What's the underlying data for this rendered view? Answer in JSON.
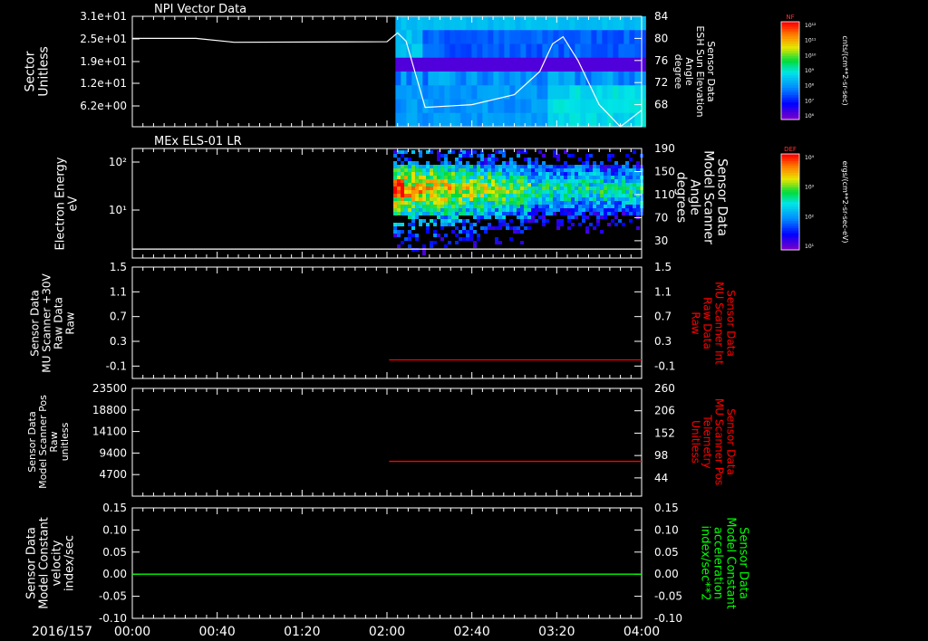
{
  "date_label": "2016/157",
  "time_ticks": [
    "00:00",
    "00:40",
    "01:20",
    "02:00",
    "02:40",
    "03:20",
    "04:00"
  ],
  "colors": {
    "background": "#000000",
    "foreground": "#ffffff",
    "red_trace": "#ff0000",
    "green_trace": "#00ff00"
  },
  "colorbars": [
    {
      "label": "NF",
      "unit": "cnts/(cm**2-sr-sec)",
      "ticks": [
        "10¹²",
        "10¹¹",
        "10¹⁰",
        "10⁹",
        "10⁸",
        "10⁷",
        "10⁶"
      ]
    },
    {
      "label": "DEF",
      "unit": "ergs/(cm**2-sr-sec-eV)",
      "ticks": [
        "10⁴",
        "10³",
        "10²",
        "10¹"
      ]
    }
  ],
  "chart_data": [
    {
      "type": "heatmap",
      "title": "NPI Vector Data",
      "ylabel": [
        "Sector",
        "Unitless"
      ],
      "left_ticks": [
        "3.1e+01",
        "2.5e+01",
        "1.9e+01",
        "1.2e+01",
        "6.2e+00"
      ],
      "right_ylabel": [
        "Sensor Data",
        "ESH Sun Elevation",
        "Angle",
        "degree"
      ],
      "right_ticks": [
        "84",
        "80",
        "76",
        "72",
        "68"
      ],
      "right_ylim": [
        64,
        84
      ],
      "data_start": "02:04",
      "overlay_line": {
        "name": "ESH Sun Elevation Angle",
        "x": [
          "00:00",
          "00:30",
          "00:48",
          "02:00",
          "02:05",
          "02:09",
          "02:18",
          "02:40",
          "03:00",
          "03:12",
          "03:18",
          "03:23",
          "03:30",
          "03:40",
          "03:50",
          "04:00"
        ],
        "y": [
          80.0,
          80.0,
          79.3,
          79.4,
          81.0,
          79.5,
          67.5,
          68.0,
          69.8,
          74.0,
          79.0,
          80.3,
          76.0,
          68.0,
          64.0,
          67.0
        ]
      }
    },
    {
      "type": "heatmap",
      "title": "MEx ELS-01 LR",
      "ylabel": [
        "Electron Energy",
        "eV"
      ],
      "left_ticks": [
        "10²",
        "10¹"
      ],
      "right_ylabel": [
        "Sensor Data",
        "Model Scanner",
        "Angle",
        "degrees"
      ],
      "right_ticks": [
        "190",
        "150",
        "110",
        "70",
        "30"
      ],
      "right_ylim": [
        0,
        190
      ],
      "data_start": "02:03",
      "overlay_line": {
        "name": "Model Scanner Angle",
        "x": [
          "00:00",
          "04:00"
        ],
        "y": [
          3,
          3
        ]
      }
    },
    {
      "type": "line",
      "ylabel": [
        "Sensor Data",
        "MU Scanner +30V",
        "Raw Data",
        "Raw"
      ],
      "ylim": [
        -0.3,
        1.5
      ],
      "left_ticks": [
        "1.5",
        "1.1",
        "0.7",
        "0.3",
        "-0.1"
      ],
      "right_ylabel": [
        "Sensor Data",
        "MU Scanner Int",
        "Raw Data",
        "Raw"
      ],
      "right_ticks": [
        "1.5",
        "1.1",
        "0.7",
        "0.3",
        "-0.1"
      ],
      "series": [
        {
          "name": "MU Scanner Int Raw Data",
          "color": "#ff0000",
          "x": [
            "02:01",
            "04:00"
          ],
          "y": [
            0.0,
            0.0
          ]
        }
      ]
    },
    {
      "type": "line",
      "ylabel": [
        "Sensor Data",
        "Model Scanner Pos",
        "Raw",
        "unitless"
      ],
      "ylim": [
        0,
        23500
      ],
      "left_ticks": [
        "23500",
        "18800",
        "14100",
        "9400",
        "4700"
      ],
      "right_ylabel": [
        "Sensor Data",
        "MU Scanner Pos",
        "Telemetry",
        "Unitless"
      ],
      "right_ticks": [
        "260",
        "206",
        "152",
        "98",
        "44"
      ],
      "right_ylim": [
        0,
        260
      ],
      "series": [
        {
          "name": "MU Scanner Pos Telemetry",
          "color": "#ff0000",
          "x": [
            "02:01",
            "04:00"
          ],
          "y": [
            84,
            84
          ]
        }
      ]
    },
    {
      "type": "line",
      "ylabel": [
        "Sensor Data",
        "Model Constant",
        "velocity",
        "index/sec"
      ],
      "ylim": [
        -0.1,
        0.15
      ],
      "left_ticks": [
        "0.15",
        "0.10",
        "0.05",
        "0.00",
        "-0.05",
        "-0.10"
      ],
      "right_ylabel": [
        "Sensor Data",
        "Model Constant",
        "acceleration",
        "index/sec**2"
      ],
      "right_ticks": [
        "0.15",
        "0.10",
        "0.05",
        "0.00",
        "-0.05",
        "-0.10"
      ],
      "series": [
        {
          "name": "Model Constant acceleration",
          "color": "#00ff00",
          "x": [
            "00:00",
            "04:00"
          ],
          "y": [
            0.0,
            0.0
          ]
        }
      ]
    }
  ]
}
